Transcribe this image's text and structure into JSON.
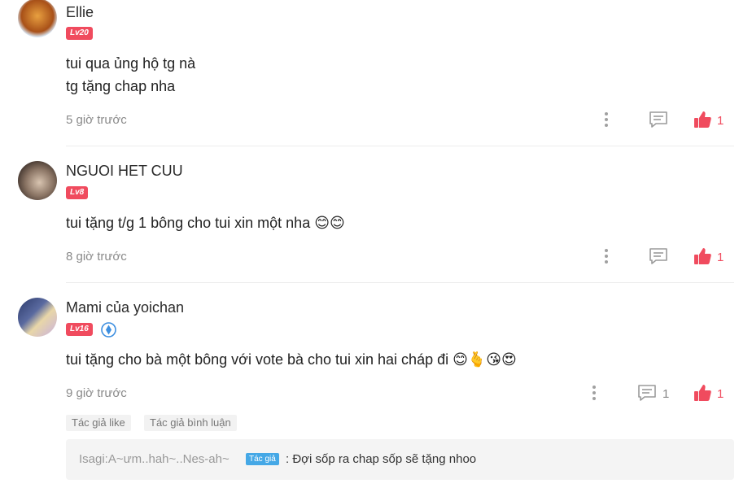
{
  "comments": [
    {
      "name": "Ellie",
      "level": "Lv20",
      "lines": [
        "tui qua ủng hộ tg nà",
        "tg tặng chap nha"
      ],
      "time": "5 giờ trước",
      "replies": "",
      "likes": "1"
    },
    {
      "name": "NGUOI HET CUU",
      "level": "Lv8",
      "lines": [
        "tui tặng t/g 1 bông cho tui xin một nha 😊😊"
      ],
      "time": "8 giờ trước",
      "replies": "",
      "likes": "1"
    },
    {
      "name": "Mami của yoichan",
      "level": "Lv16",
      "lines": [
        "tui tặng cho bà một bông với vote bà cho tui xin hai cháp đi 😊🫰😘😍"
      ],
      "time": "9 giờ trước",
      "replies": "1",
      "likes": "1",
      "tags": [
        "Tác giả like",
        "Tác giả bình luận"
      ],
      "reply": {
        "user": "Isagi:A~ưm..hah~..Nes-ah~",
        "badge": "Tác giả",
        "text": ": Đợi sốp ra chap sốp sẽ tặng nhoo"
      }
    }
  ],
  "icons": {
    "more": "more-vertical-icon",
    "reply": "comment-icon",
    "like": "thumbs-up-icon",
    "verified": "diamond-badge-icon"
  },
  "colors": {
    "accent": "#f04b5e",
    "badge": "#45a8e6"
  }
}
